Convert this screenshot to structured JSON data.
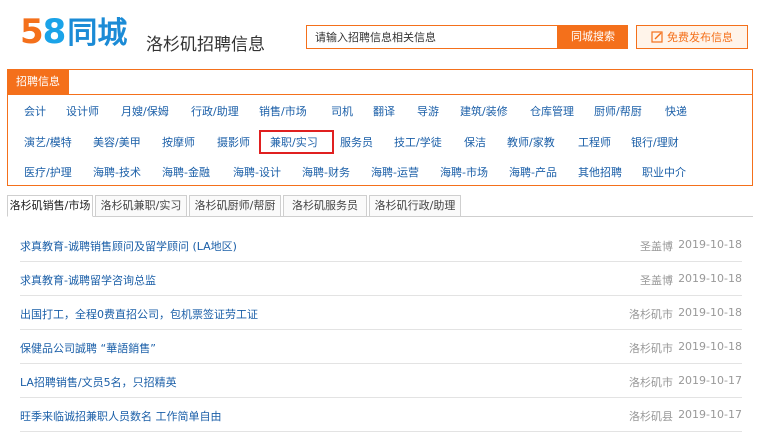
{
  "header": {
    "logo_num_5": "5",
    "logo_num_8": "8",
    "logo_text": "同城",
    "city_title": "洛杉矶招聘信息",
    "search_placeholder": "请输入招聘信息相关信息",
    "search_button": "同城搜索",
    "post_button": "免费发布信息"
  },
  "categories": {
    "tab_label": "招聘信息",
    "row1": [
      "会计",
      "设计师",
      "月嫂/保姆",
      "行政/助理",
      "销售/市场",
      "司机",
      "翻译",
      "导游",
      "建筑/装修",
      "仓库管理",
      "厨师/帮厨",
      "快递"
    ],
    "row2": [
      "演艺/模特",
      "美容/美甲",
      "按摩师",
      "摄影师",
      "兼职/实习",
      "服务员",
      "技工/学徒",
      "保洁",
      "教师/家教",
      "工程师",
      "银行/理财"
    ],
    "row3": [
      "医疗/护理",
      "海聘-技术",
      "海聘-金融",
      "海聘-设计",
      "海聘-财务",
      "海聘-运营",
      "海聘-市场",
      "海聘-产品",
      "其他招聘",
      "职业中介"
    ],
    "highlighted": "兼职/实习"
  },
  "tabs": [
    "洛杉矶销售/市场",
    "洛杉矶兼职/实习",
    "洛杉矶厨师/帮厨",
    "洛杉矶服务员",
    "洛杉矶行政/助理"
  ],
  "listings": [
    {
      "title": "求真教育-诚聘销售顾问及留学顾问 (LA地区)",
      "location": "圣盖博",
      "date": "2019-10-18"
    },
    {
      "title": "求真教育-诚聘留学咨询总监",
      "location": "圣盖博",
      "date": "2019-10-18"
    },
    {
      "title": "出国打工，全程0费直招公司，包机票签证劳工证",
      "location": "洛杉矶市",
      "date": "2019-10-18"
    },
    {
      "title": "保健品公司誠聘 “華語銷售”",
      "location": "洛杉矶市",
      "date": "2019-10-18"
    },
    {
      "title": "LA招聘销售/文员5名，只招精英",
      "location": "洛杉矶市",
      "date": "2019-10-17"
    },
    {
      "title": "旺季来临诚招兼职人员数名 工作简单自由",
      "location": "洛杉矶县",
      "date": "2019-10-17"
    }
  ],
  "colors": {
    "accent": "#f4701b",
    "link": "#1b5fa8",
    "highlight_box": "#e02020"
  }
}
